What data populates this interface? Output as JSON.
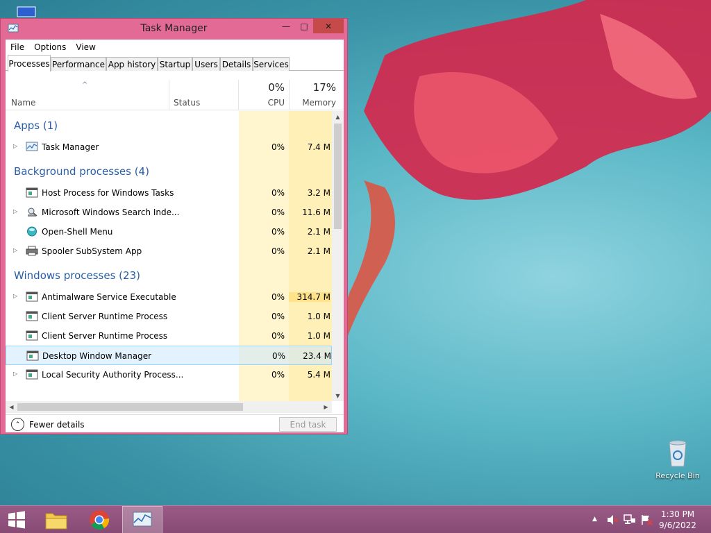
{
  "window": {
    "title": "Task Manager",
    "minimize_glyph": "—",
    "maximize_glyph": "□",
    "close_glyph": "✕"
  },
  "menu": [
    "File",
    "Options",
    "View"
  ],
  "tabs": [
    "Processes",
    "Performance",
    "App history",
    "Startup",
    "Users",
    "Details",
    "Services"
  ],
  "columns": {
    "sort_glyph": "^",
    "name": "Name",
    "status": "Status",
    "cpu_pct": "0%",
    "cpu": "CPU",
    "mem_pct": "17%",
    "memory": "Memory"
  },
  "groups": [
    {
      "label": "Apps (1)",
      "rows": [
        {
          "name": "Task Manager",
          "cpu": "0%",
          "mem": "7.4 M",
          "expand": true,
          "icon": "task-manager-icon"
        }
      ]
    },
    {
      "label": "Background processes (4)",
      "rows": [
        {
          "name": "Host Process for Windows Tasks",
          "cpu": "0%",
          "mem": "3.2 M",
          "expand": false,
          "icon": "process-window-icon"
        },
        {
          "name": "Microsoft Windows Search Inde...",
          "cpu": "0%",
          "mem": "11.6 M",
          "expand": true,
          "icon": "search-indexer-icon"
        },
        {
          "name": "Open-Shell Menu",
          "cpu": "0%",
          "mem": "2.1 M",
          "expand": false,
          "icon": "open-shell-icon"
        },
        {
          "name": "Spooler SubSystem App",
          "cpu": "0%",
          "mem": "2.1 M",
          "expand": true,
          "icon": "printer-icon"
        }
      ]
    },
    {
      "label": "Windows processes (23)",
      "rows": [
        {
          "name": "Antimalware Service Executable",
          "cpu": "0%",
          "mem": "314.7 M",
          "expand": true,
          "icon": "process-window-icon"
        },
        {
          "name": "Client Server Runtime Process",
          "cpu": "0%",
          "mem": "1.0 M",
          "expand": false,
          "icon": "process-window-icon"
        },
        {
          "name": "Client Server Runtime Process",
          "cpu": "0%",
          "mem": "1.0 M",
          "expand": false,
          "icon": "process-window-icon"
        },
        {
          "name": "Desktop Window Manager",
          "cpu": "0%",
          "mem": "23.4 M",
          "expand": false,
          "icon": "process-window-icon",
          "selected": true
        },
        {
          "name": "Local Security Authority Process...",
          "cpu": "0%",
          "mem": "5.4 M",
          "expand": true,
          "icon": "process-window-icon"
        }
      ]
    }
  ],
  "footer": {
    "fewer_details": "Fewer details",
    "end_task": "End task"
  },
  "desktop": {
    "recycle_bin": "Recycle Bin"
  },
  "taskbar": {
    "time": "1:30 PM",
    "date": "9/6/2022",
    "tray_chevron": "▲"
  },
  "colors": {
    "window_frame": "#e36a95",
    "group_header": "#2a5fa8",
    "cpu_column": "#fff6d0",
    "memory_column": "#fff0b8",
    "taskbar": "#874a74"
  }
}
